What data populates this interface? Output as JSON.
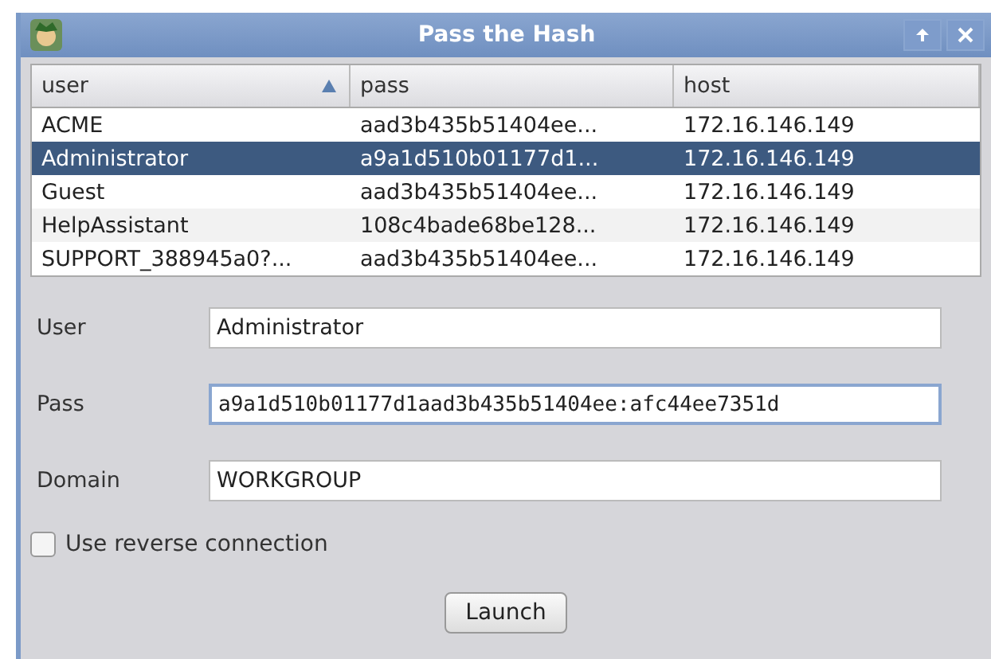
{
  "window": {
    "title": "Pass the Hash"
  },
  "table": {
    "columns": [
      {
        "label": "user",
        "sorted": true
      },
      {
        "label": "pass",
        "sorted": false
      },
      {
        "label": "host",
        "sorted": false
      }
    ],
    "rows": [
      {
        "cells": [
          "ACME",
          "aad3b435b51404ee...",
          "172.16.146.149"
        ],
        "selected": false
      },
      {
        "cells": [
          "Administrator",
          "a9a1d510b01177d1...",
          "172.16.146.149"
        ],
        "selected": true
      },
      {
        "cells": [
          "Guest",
          "aad3b435b51404ee...",
          "172.16.146.149"
        ],
        "selected": false
      },
      {
        "cells": [
          "HelpAssistant",
          "108c4bade68be128...",
          "172.16.146.149"
        ],
        "selected": false
      },
      {
        "cells": [
          "SUPPORT_388945a0?...",
          "aad3b435b51404ee...",
          "172.16.146.149"
        ],
        "selected": false
      }
    ]
  },
  "fields": [
    {
      "label": "User",
      "value": "Administrator",
      "focused": false
    },
    {
      "label": "Pass",
      "value": "a9a1d510b01177d1aad3b435b51404ee:afc44ee7351d",
      "focused": true
    },
    {
      "label": "Domain",
      "value": "WORKGROUP",
      "focused": false
    }
  ],
  "reverse_connection": {
    "label": "Use reverse connection",
    "checked": false
  },
  "buttons": [
    "Launch"
  ]
}
